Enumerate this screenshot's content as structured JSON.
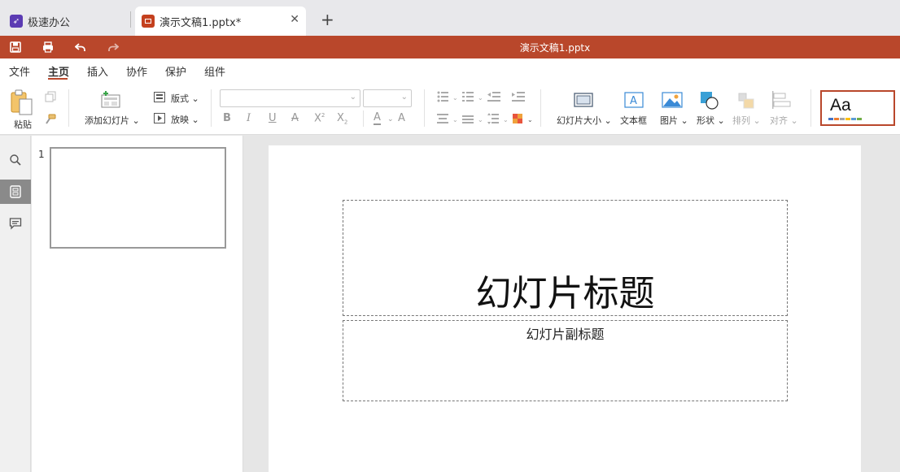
{
  "tabs": [
    {
      "label": "极速办公"
    },
    {
      "label": "演示文稿1.pptx*"
    }
  ],
  "titlebar": {
    "title": "演示文稿1.pptx"
  },
  "menu": {
    "items": [
      "文件",
      "主页",
      "插入",
      "协作",
      "保护",
      "组件"
    ],
    "active": "主页"
  },
  "ribbon": {
    "paste": "粘贴",
    "add_slide": "添加幻灯片",
    "layout": "版式",
    "slideshow": "放映",
    "slide_size": "幻灯片大小",
    "textbox": "文本框",
    "picture": "图片",
    "shape": "形状",
    "arrange": "排列",
    "align": "对齐",
    "theme_preview": "Aa"
  },
  "thumbnails": [
    {
      "number": "1"
    }
  ],
  "slide": {
    "title": "幻灯片标题",
    "subtitle": "幻灯片副标题"
  },
  "colors": {
    "brand": "#b9472b",
    "app_icon": "#5b3bb3",
    "doc_icon": "#c4401e"
  }
}
